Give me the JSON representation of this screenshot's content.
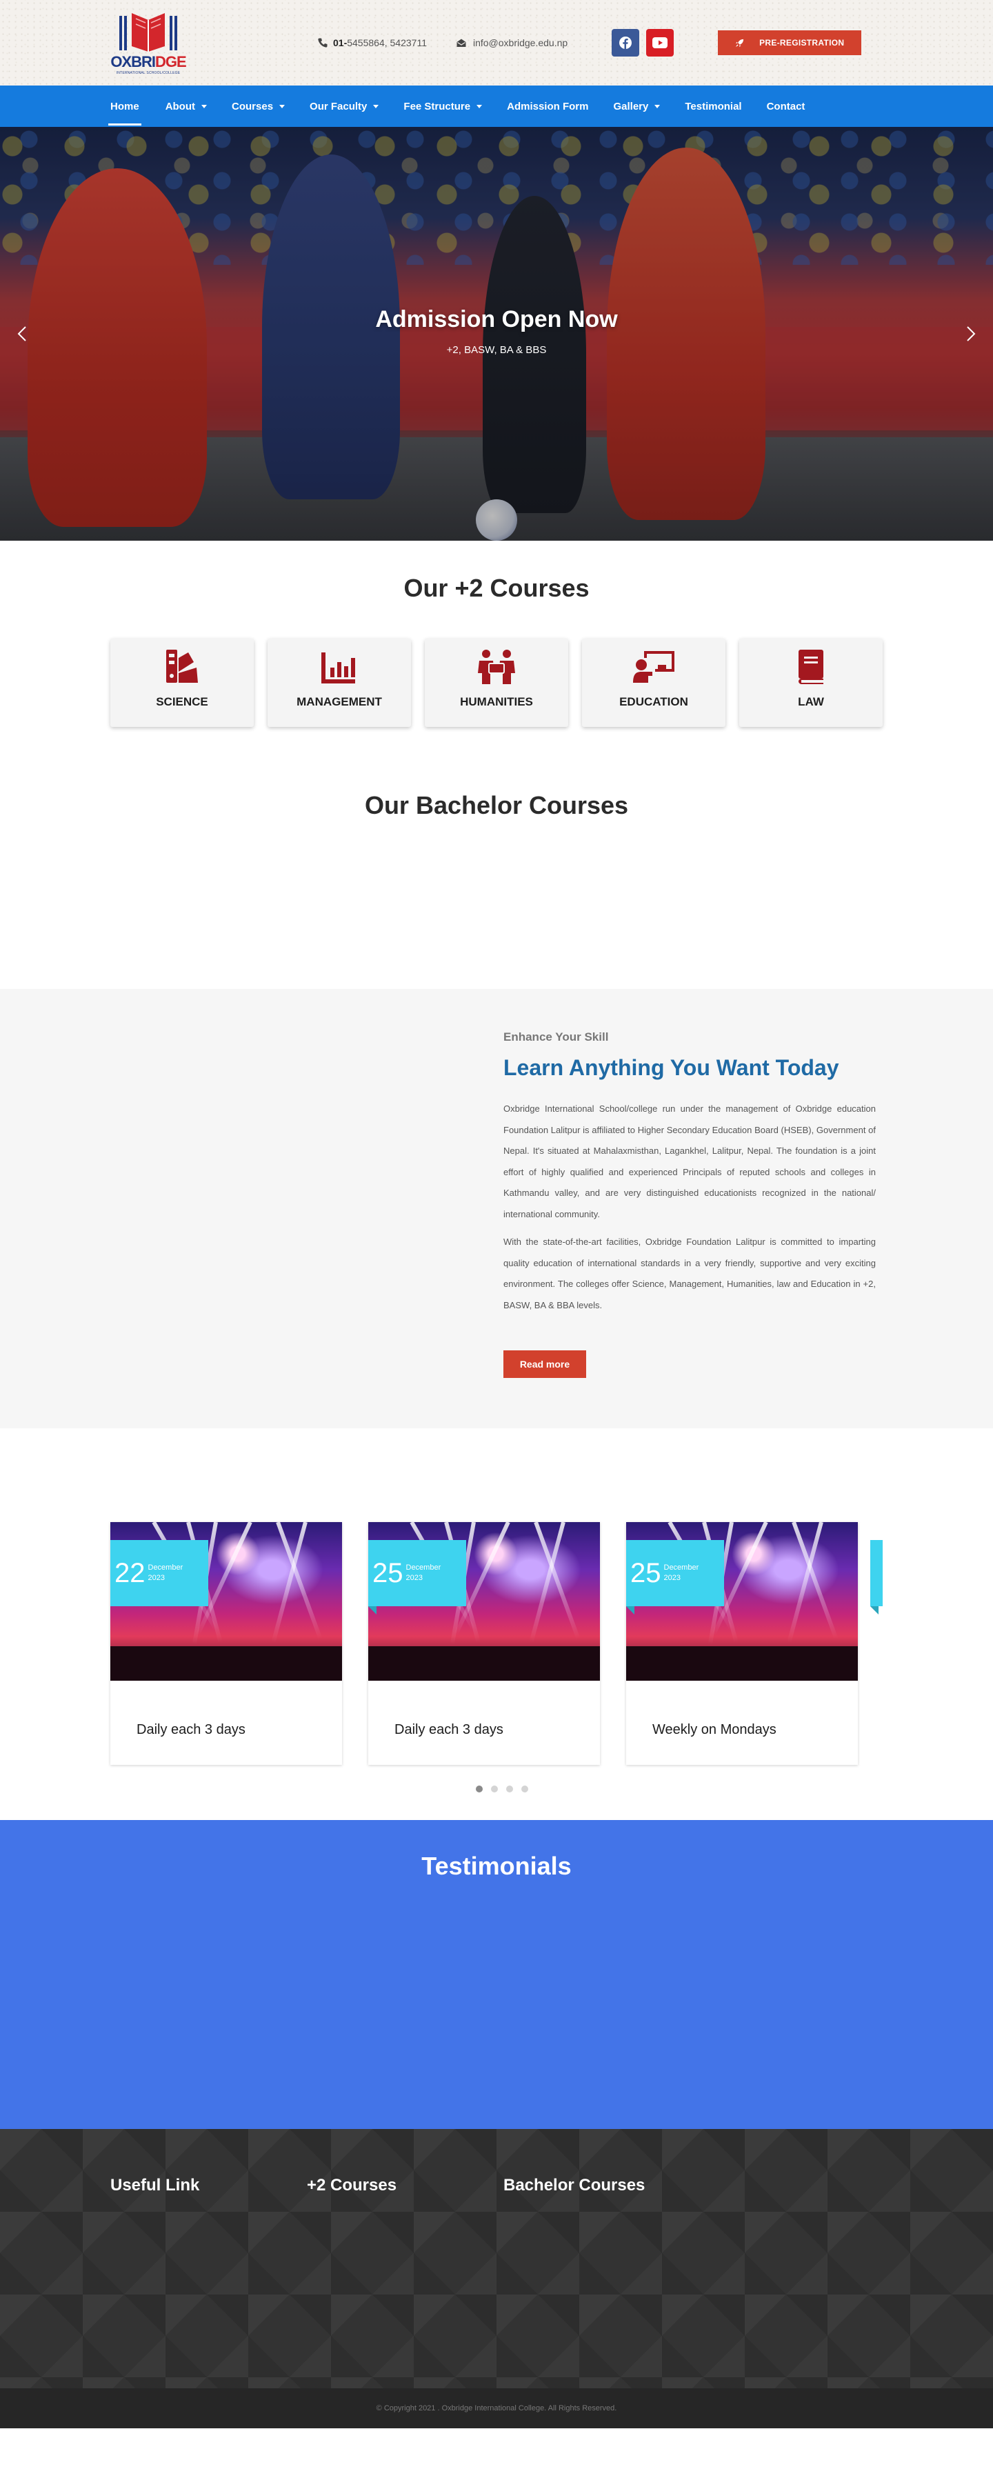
{
  "header": {
    "logo_main": "OXBRI",
    "logo_accent": "DGE",
    "logo_tagline": "INTERNATIONAL SCHOOL/COLLEGE",
    "phone_prefix": "01-",
    "phone_numbers": "5455864, 5423711",
    "email": "info@oxbridge.edu.np",
    "social": {
      "facebook_icon": "facebook-icon",
      "youtube_icon": "youtube-icon"
    },
    "prereg_label": "PRE-REGISTRATION",
    "colors": {
      "facebook": "#3b5998",
      "youtube": "#d81e25",
      "cta": "#d2412d"
    }
  },
  "nav": {
    "color": "#157bde",
    "items": [
      {
        "label": "Home",
        "dropdown": false,
        "active": true
      },
      {
        "label": "About",
        "dropdown": true
      },
      {
        "label": "Courses",
        "dropdown": true
      },
      {
        "label": "Our Faculty",
        "dropdown": true
      },
      {
        "label": "Fee Structure",
        "dropdown": true
      },
      {
        "label": "Admission Form",
        "dropdown": false
      },
      {
        "label": "Gallery",
        "dropdown": true
      },
      {
        "label": "Testimonial",
        "dropdown": false
      },
      {
        "label": "Contact",
        "dropdown": false
      }
    ]
  },
  "hero": {
    "title": "Admission Open Now",
    "subtitle": "+2, BASW, BA & BBS",
    "prev_icon": "chevron-left-icon",
    "next_icon": "chevron-right-icon"
  },
  "plus2": {
    "title": "Our +2 Courses",
    "courses": [
      {
        "label": "SCIENCE",
        "icon": "science-icon"
      },
      {
        "label": "MANAGEMENT",
        "icon": "chart-icon"
      },
      {
        "label": "HUMANITIES",
        "icon": "people-icon"
      },
      {
        "label": "EDUCATION",
        "icon": "teacher-icon"
      },
      {
        "label": "LAW",
        "icon": "book-icon"
      }
    ],
    "icon_color": "#a3181f"
  },
  "bachelor": {
    "title": "Our Bachelor Courses"
  },
  "about": {
    "kicker": "Enhance Your Skill",
    "title": "Learn Anything You Want Today",
    "paragraph1": "Oxbridge International School/college run under the management of Oxbridge education Foundation Lalitpur is affiliated to Higher Secondary Education Board (HSEB), Government of Nepal. It's situated at Mahalaxmisthan, Lagankhel, Lalitpur, Nepal. The foundation is a joint effort of highly qualified and experienced Principals of reputed schools and colleges in Kathmandu valley, and are very distinguished educationists recognized in the national/ international community.",
    "paragraph2": "With the state-of-the-art facilities, Oxbridge Foundation Lalitpur is committed to imparting quality education of international standards in a very friendly, supportive and very exciting environment. The colleges offer Science, Management, Humanities, law and Education in +2, BASW, BA & BBA levels.",
    "button_label": "Read more"
  },
  "events": {
    "items": [
      {
        "day": "22",
        "month": "December",
        "year": "2023",
        "name": "Daily each 3 days"
      },
      {
        "day": "25",
        "month": "December",
        "year": "2023",
        "name": "Daily each 3 days"
      },
      {
        "day": "25",
        "month": "December",
        "year": "2023",
        "name": "Weekly on Mondays"
      }
    ],
    "dots": 4,
    "active_dot": 1,
    "date_color": "#3ed3ef"
  },
  "testimonials": {
    "title": "Testimonials",
    "background": "#4374e8"
  },
  "footer": {
    "columns": [
      {
        "title": "Useful Link"
      },
      {
        "title": "+2 Courses"
      },
      {
        "title": "Bachelor Courses"
      }
    ],
    "copyright": "© Copyright 2021 . Oxbridge International College. All Rights Reserved."
  }
}
